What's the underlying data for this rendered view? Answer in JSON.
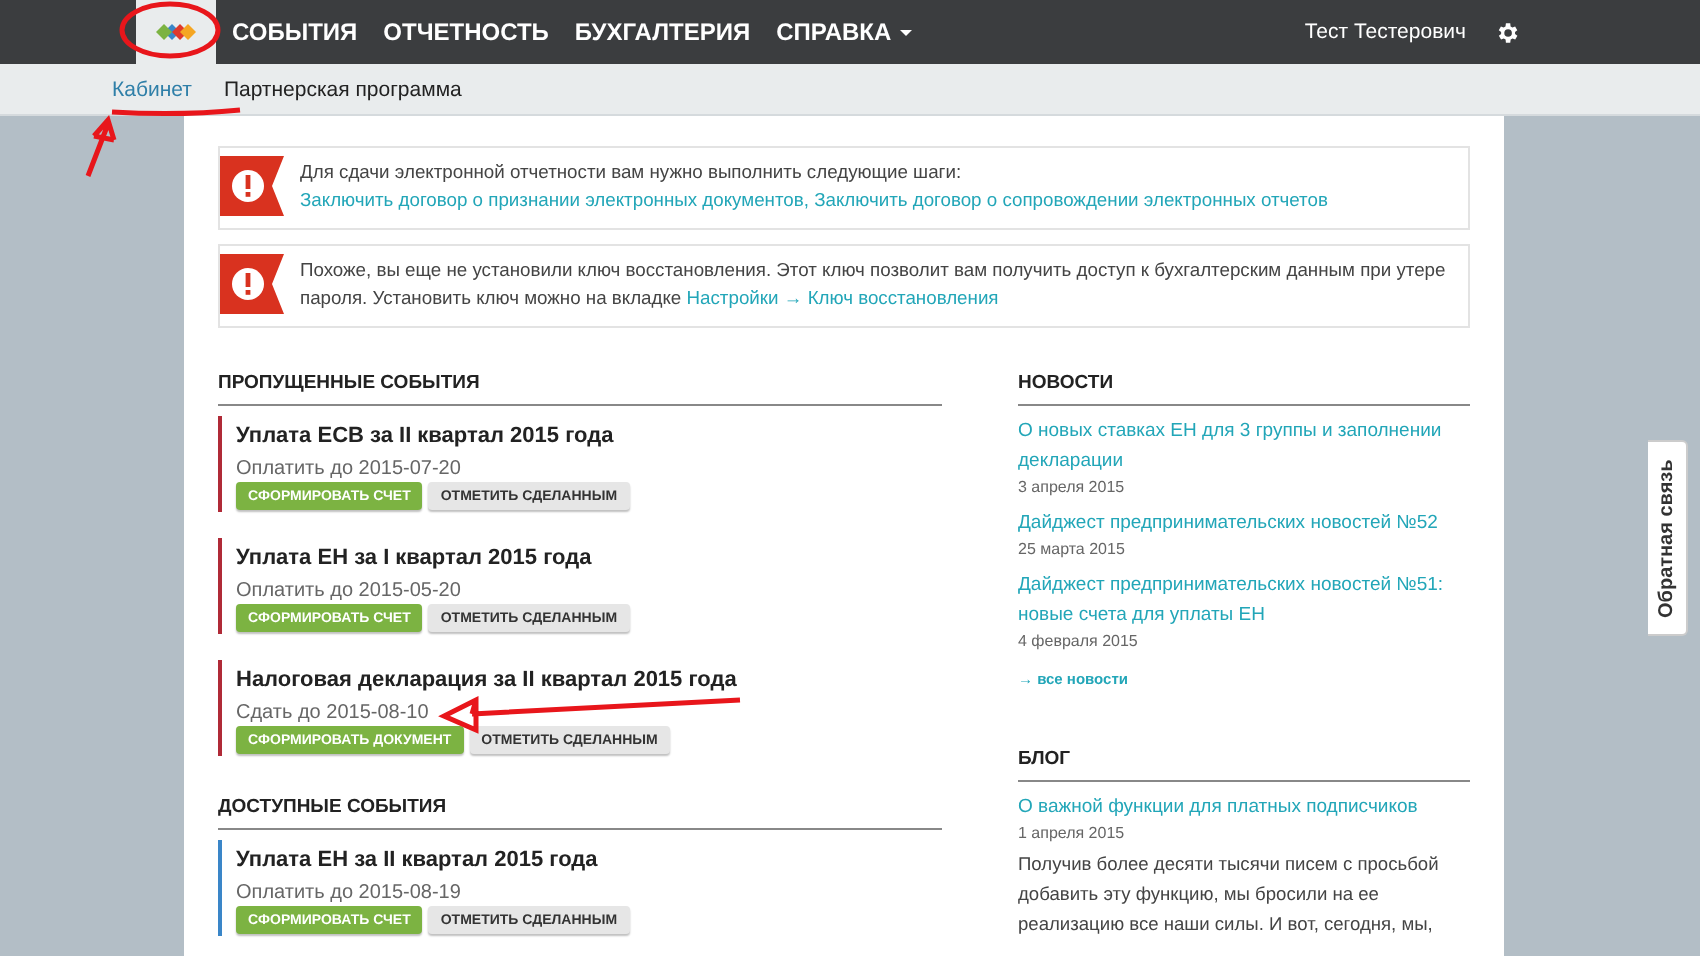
{
  "navbar": {
    "menu": [
      {
        "label": "СОБЫТИЯ",
        "dropdown": false
      },
      {
        "label": "ОТЧЕТНОСТЬ",
        "dropdown": false
      },
      {
        "label": "БУХГАЛТЕРИЯ",
        "dropdown": false
      },
      {
        "label": "СПРАВКА",
        "dropdown": true
      }
    ],
    "user": "Тест Тестерович"
  },
  "subnav": [
    {
      "label": "Кабинет",
      "selected": true
    },
    {
      "label": "Партнерская программа",
      "selected": false
    }
  ],
  "alerts": [
    {
      "text": "Для сдачи электронной отчетности вам нужно выполнить следующие шаги:",
      "links": [
        "Заключить договор о признании электронных документов, Заключить договор о сопровождении электронных отчетов"
      ]
    },
    {
      "text": "Похоже, вы еще не установили ключ восстановления. Этот ключ позволит вам получить доступ к бухгалтерским данным при утере пароля. Установить ключ можно на вкладке",
      "links": [
        "Настройки → Ключ восстановления"
      ]
    }
  ],
  "sections": [
    {
      "title": "ПРОПУЩЕННЫЕ СОБЫТИЯ",
      "kind": "missed",
      "events": [
        {
          "title": "Уплата ЕСВ за II квартал 2015 года",
          "due": "Оплатить до 2015-07-20",
          "buttons": [
            {
              "label": "СФОРМИРОВАТЬ СЧЕТ",
              "kind": "primary"
            },
            {
              "label": "ОТМЕТИТЬ СДЕЛАННЫМ",
              "kind": "secondary"
            }
          ]
        },
        {
          "title": "Уплата ЕН за I квартал 2015 года",
          "due": "Оплатить до 2015-05-20",
          "buttons": [
            {
              "label": "СФОРМИРОВАТЬ СЧЕТ",
              "kind": "primary"
            },
            {
              "label": "ОТМЕТИТЬ СДЕЛАННЫМ",
              "kind": "secondary"
            }
          ]
        },
        {
          "title": "Налоговая декларация за II квартал 2015 года",
          "due": "Сдать до 2015-08-10",
          "buttons": [
            {
              "label": "СФОРМИРОВАТЬ ДОКУМЕНТ",
              "kind": "primary"
            },
            {
              "label": "ОТМЕТИТЬ СДЕЛАННЫМ",
              "kind": "secondary"
            }
          ]
        }
      ]
    },
    {
      "title": "ДОСТУПНЫЕ СОБЫТИЯ",
      "kind": "available",
      "events": [
        {
          "title": "Уплата ЕН за II квартал 2015 года",
          "due": "Оплатить до 2015-08-19",
          "buttons": [
            {
              "label": "СФОРМИРОВАТЬ СЧЕТ",
              "kind": "primary"
            },
            {
              "label": "ОТМЕТИТЬ СДЕЛАННЫМ",
              "kind": "secondary"
            }
          ]
        }
      ]
    }
  ],
  "news": {
    "title": "НОВОСТИ",
    "items": [
      {
        "title": "О новых ставках ЕН для 3 группы и заполнении декларации",
        "date": "3 апреля 2015"
      },
      {
        "title": "Дайджест предпринимательских новостей №52",
        "date": "25 марта 2015"
      },
      {
        "title": "Дайджест предпринимательских новостей №51: новые счета для уплаты ЕН",
        "date": "4 февраля 2015"
      }
    ],
    "more": "→ все новости"
  },
  "blog": {
    "title": "БЛОГ",
    "items": [
      {
        "title": "О важной функции для платных подписчиков",
        "date": "1 апреля 2015",
        "text": "Получив более десяти тысячи писем с просьбой добавить эту функцию, мы бросили на ее реализацию все наши силы. И вот, сегодня, мы,"
      }
    ]
  },
  "feedback": "Обратная связь"
}
